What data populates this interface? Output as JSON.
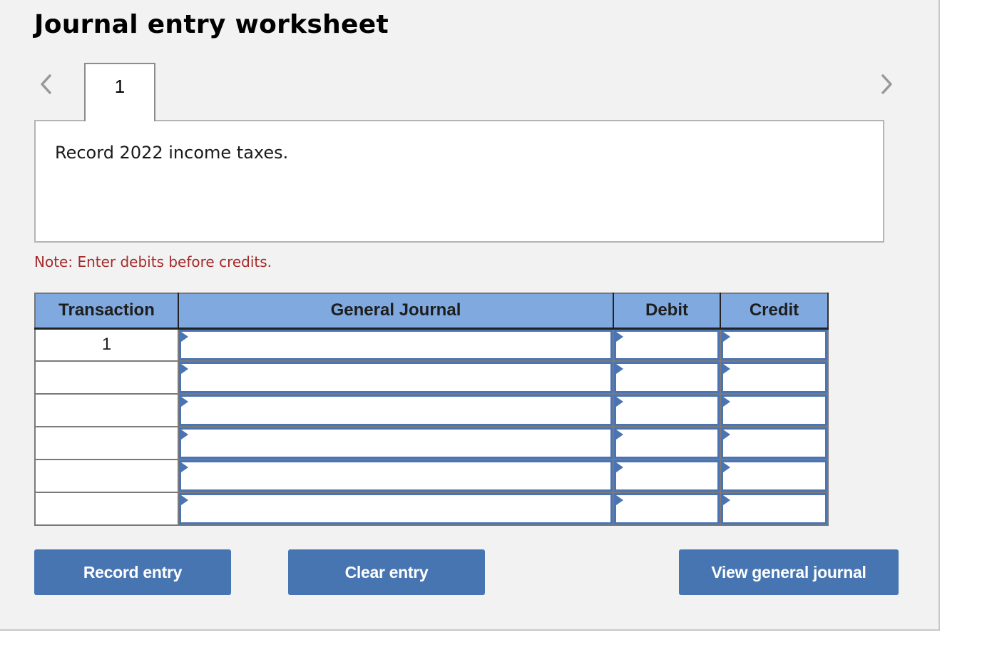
{
  "page": {
    "title": "Journal entry worksheet"
  },
  "navigation": {
    "prev_icon": "chevron-left-icon",
    "next_icon": "chevron-right-icon",
    "tabs": [
      {
        "label": "1",
        "active": true
      }
    ]
  },
  "prompt": {
    "text": "Record 2022 income taxes."
  },
  "note": {
    "text": "Note: Enter debits before credits.",
    "color": "#a52a2a"
  },
  "journal_table": {
    "header_color": "#80a9df",
    "columns": [
      "Transaction",
      "General Journal",
      "Debit",
      "Credit"
    ],
    "rows": [
      {
        "transaction": "1",
        "account": "",
        "debit": "",
        "credit": ""
      },
      {
        "transaction": "",
        "account": "",
        "debit": "",
        "credit": ""
      },
      {
        "transaction": "",
        "account": "",
        "debit": "",
        "credit": ""
      },
      {
        "transaction": "",
        "account": "",
        "debit": "",
        "credit": ""
      },
      {
        "transaction": "",
        "account": "",
        "debit": "",
        "credit": ""
      },
      {
        "transaction": "",
        "account": "",
        "debit": "",
        "credit": ""
      }
    ]
  },
  "buttons": {
    "record": "Record entry",
    "clear": "Clear entry",
    "view": "View general journal",
    "color": "#4775b2"
  }
}
